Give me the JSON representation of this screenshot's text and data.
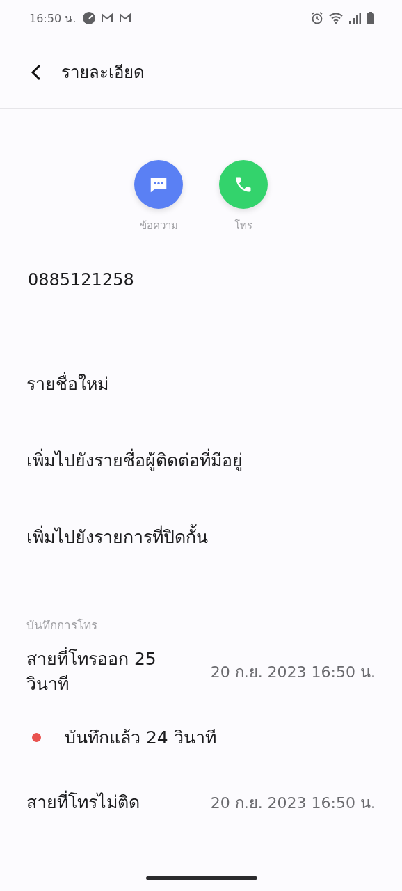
{
  "status_bar": {
    "time": "16:50 น."
  },
  "header": {
    "title": "รายละเอียด"
  },
  "actions": [
    {
      "kind": "message",
      "label": "ข้อความ",
      "color": "#5a80f4"
    },
    {
      "kind": "call",
      "label": "โทร",
      "color": "#33d36c"
    }
  ],
  "phone_number": "0885121258",
  "menu": [
    "รายชื่อใหม่",
    "เพิ่มไปยังรายชื่อผู้ติดต่อที่มีอยู่",
    "เพิ่มไปยังรายการที่ปิดกั้น"
  ],
  "call_log": {
    "title": "บันทึกการโทร",
    "entries": [
      {
        "kind": "call",
        "label": "สายที่โทรออก 25 วินาที",
        "time": "20 ก.ย. 2023 16:50 น."
      },
      {
        "kind": "recording",
        "label": "บันทึกแล้ว 24 วินาที",
        "color": "#e9524f"
      },
      {
        "kind": "call",
        "label": "สายที่โทรไม่ติด",
        "time": "20 ก.ย. 2023 16:50 น."
      }
    ]
  }
}
